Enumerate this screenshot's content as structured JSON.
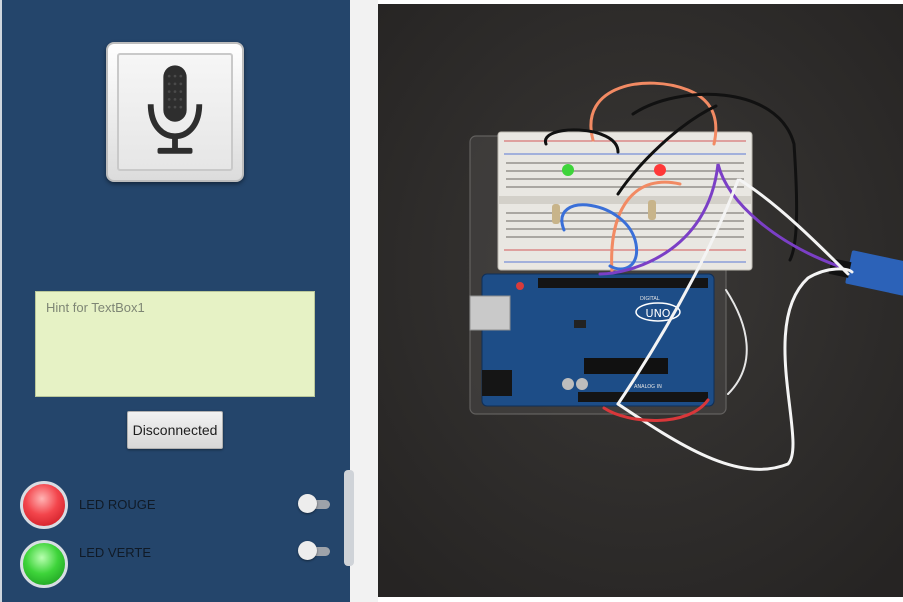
{
  "app": {
    "textbox": {
      "placeholder": "Hint for TextBox1"
    },
    "connect_button": {
      "label": "Disconnected"
    },
    "leds": [
      {
        "label": "LED ROUGE",
        "color": "#e8343d",
        "switch_on": false
      },
      {
        "label": "LED VERTE",
        "color": "#2fc43a",
        "switch_on": false
      }
    ],
    "icons": {
      "mic_button": "microphone-icon"
    }
  },
  "photo": {
    "board_label": "UNO",
    "board_text": "DIGITAL",
    "board_text2": "ANALOG IN"
  },
  "colors": {
    "panel_bg": "#24456b",
    "textbox_bg": "#e6f2c5",
    "photo_bg": "#2e2c2b"
  }
}
